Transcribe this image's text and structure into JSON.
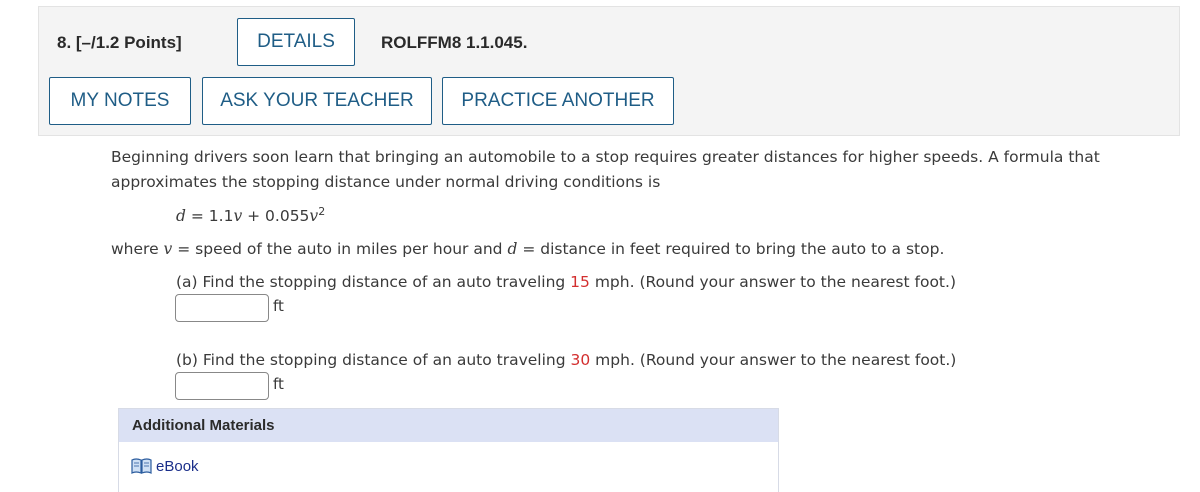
{
  "header": {
    "question_label": "8. [–/1.2 Points]",
    "details_label": "DETAILS",
    "code": "ROLFFM8 1.1.045.",
    "my_notes_label": "MY NOTES",
    "ask_teacher_label": "ASK YOUR TEACHER",
    "practice_label": "PRACTICE ANOTHER"
  },
  "problem": {
    "intro_line1": "Beginning drivers soon learn that bringing an automobile to a stop requires greater distances for higher speeds. A formula that",
    "intro_line2": "approximates the stopping distance under normal driving conditions is",
    "formula": {
      "lhs": "d",
      "eq": " = 1.1",
      "v1": "v",
      "plus": " + 0.055",
      "v2": "v",
      "exp": "2"
    },
    "where": {
      "pre": "where ",
      "v": "v",
      "mid": " = speed of the auto in miles per hour and ",
      "d": "d",
      "post": " = distance in feet required to bring the auto to a stop."
    },
    "part_a": {
      "pre": "(a) Find the stopping distance of an auto traveling ",
      "speed": "15",
      "post": " mph. (Round your answer to the nearest foot.)",
      "value": "",
      "unit": "ft"
    },
    "part_b": {
      "pre": "(b) Find the stopping distance of an auto traveling ",
      "speed": "30",
      "post": " mph. (Round your answer to the nearest foot.)",
      "value": "",
      "unit": "ft"
    }
  },
  "additional": {
    "header": "Additional Materials",
    "ebook_label": "eBook"
  },
  "colors": {
    "button_border": "#1f5d86",
    "highlight_red": "#d32f2f",
    "materials_header_bg": "#dbe1f4",
    "link_blue": "#1a2e8a"
  }
}
